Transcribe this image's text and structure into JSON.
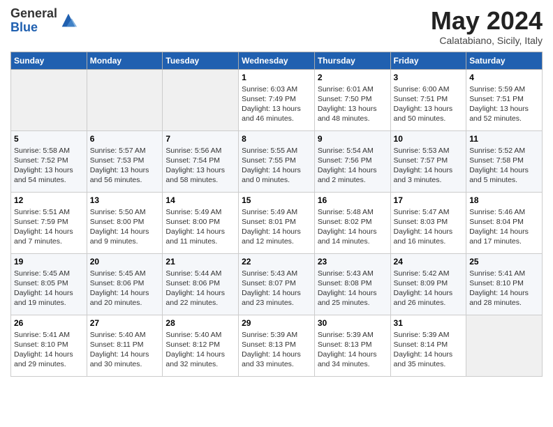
{
  "logo": {
    "general": "General",
    "blue": "Blue"
  },
  "title": "May 2024",
  "subtitle": "Calatabiano, Sicily, Italy",
  "days_of_week": [
    "Sunday",
    "Monday",
    "Tuesday",
    "Wednesday",
    "Thursday",
    "Friday",
    "Saturday"
  ],
  "weeks": [
    [
      {
        "day": "",
        "info": ""
      },
      {
        "day": "",
        "info": ""
      },
      {
        "day": "",
        "info": ""
      },
      {
        "day": "1",
        "info": "Sunrise: 6:03 AM\nSunset: 7:49 PM\nDaylight: 13 hours\nand 46 minutes."
      },
      {
        "day": "2",
        "info": "Sunrise: 6:01 AM\nSunset: 7:50 PM\nDaylight: 13 hours\nand 48 minutes."
      },
      {
        "day": "3",
        "info": "Sunrise: 6:00 AM\nSunset: 7:51 PM\nDaylight: 13 hours\nand 50 minutes."
      },
      {
        "day": "4",
        "info": "Sunrise: 5:59 AM\nSunset: 7:51 PM\nDaylight: 13 hours\nand 52 minutes."
      }
    ],
    [
      {
        "day": "5",
        "info": "Sunrise: 5:58 AM\nSunset: 7:52 PM\nDaylight: 13 hours\nand 54 minutes."
      },
      {
        "day": "6",
        "info": "Sunrise: 5:57 AM\nSunset: 7:53 PM\nDaylight: 13 hours\nand 56 minutes."
      },
      {
        "day": "7",
        "info": "Sunrise: 5:56 AM\nSunset: 7:54 PM\nDaylight: 13 hours\nand 58 minutes."
      },
      {
        "day": "8",
        "info": "Sunrise: 5:55 AM\nSunset: 7:55 PM\nDaylight: 14 hours\nand 0 minutes."
      },
      {
        "day": "9",
        "info": "Sunrise: 5:54 AM\nSunset: 7:56 PM\nDaylight: 14 hours\nand 2 minutes."
      },
      {
        "day": "10",
        "info": "Sunrise: 5:53 AM\nSunset: 7:57 PM\nDaylight: 14 hours\nand 3 minutes."
      },
      {
        "day": "11",
        "info": "Sunrise: 5:52 AM\nSunset: 7:58 PM\nDaylight: 14 hours\nand 5 minutes."
      }
    ],
    [
      {
        "day": "12",
        "info": "Sunrise: 5:51 AM\nSunset: 7:59 PM\nDaylight: 14 hours\nand 7 minutes."
      },
      {
        "day": "13",
        "info": "Sunrise: 5:50 AM\nSunset: 8:00 PM\nDaylight: 14 hours\nand 9 minutes."
      },
      {
        "day": "14",
        "info": "Sunrise: 5:49 AM\nSunset: 8:00 PM\nDaylight: 14 hours\nand 11 minutes."
      },
      {
        "day": "15",
        "info": "Sunrise: 5:49 AM\nSunset: 8:01 PM\nDaylight: 14 hours\nand 12 minutes."
      },
      {
        "day": "16",
        "info": "Sunrise: 5:48 AM\nSunset: 8:02 PM\nDaylight: 14 hours\nand 14 minutes."
      },
      {
        "day": "17",
        "info": "Sunrise: 5:47 AM\nSunset: 8:03 PM\nDaylight: 14 hours\nand 16 minutes."
      },
      {
        "day": "18",
        "info": "Sunrise: 5:46 AM\nSunset: 8:04 PM\nDaylight: 14 hours\nand 17 minutes."
      }
    ],
    [
      {
        "day": "19",
        "info": "Sunrise: 5:45 AM\nSunset: 8:05 PM\nDaylight: 14 hours\nand 19 minutes."
      },
      {
        "day": "20",
        "info": "Sunrise: 5:45 AM\nSunset: 8:06 PM\nDaylight: 14 hours\nand 20 minutes."
      },
      {
        "day": "21",
        "info": "Sunrise: 5:44 AM\nSunset: 8:06 PM\nDaylight: 14 hours\nand 22 minutes."
      },
      {
        "day": "22",
        "info": "Sunrise: 5:43 AM\nSunset: 8:07 PM\nDaylight: 14 hours\nand 23 minutes."
      },
      {
        "day": "23",
        "info": "Sunrise: 5:43 AM\nSunset: 8:08 PM\nDaylight: 14 hours\nand 25 minutes."
      },
      {
        "day": "24",
        "info": "Sunrise: 5:42 AM\nSunset: 8:09 PM\nDaylight: 14 hours\nand 26 minutes."
      },
      {
        "day": "25",
        "info": "Sunrise: 5:41 AM\nSunset: 8:10 PM\nDaylight: 14 hours\nand 28 minutes."
      }
    ],
    [
      {
        "day": "26",
        "info": "Sunrise: 5:41 AM\nSunset: 8:10 PM\nDaylight: 14 hours\nand 29 minutes."
      },
      {
        "day": "27",
        "info": "Sunrise: 5:40 AM\nSunset: 8:11 PM\nDaylight: 14 hours\nand 30 minutes."
      },
      {
        "day": "28",
        "info": "Sunrise: 5:40 AM\nSunset: 8:12 PM\nDaylight: 14 hours\nand 32 minutes."
      },
      {
        "day": "29",
        "info": "Sunrise: 5:39 AM\nSunset: 8:13 PM\nDaylight: 14 hours\nand 33 minutes."
      },
      {
        "day": "30",
        "info": "Sunrise: 5:39 AM\nSunset: 8:13 PM\nDaylight: 14 hours\nand 34 minutes."
      },
      {
        "day": "31",
        "info": "Sunrise: 5:39 AM\nSunset: 8:14 PM\nDaylight: 14 hours\nand 35 minutes."
      },
      {
        "day": "",
        "info": ""
      }
    ]
  ]
}
